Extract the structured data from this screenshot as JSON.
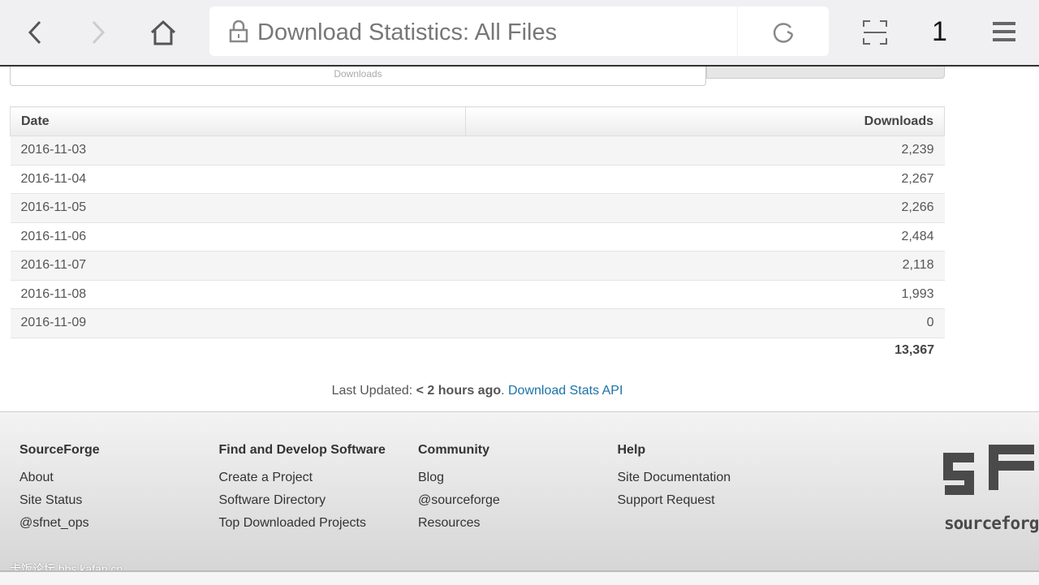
{
  "browser": {
    "page_title": "Download Statistics: All Files",
    "tab_count": "1"
  },
  "chart": {
    "x_label": "Downloads"
  },
  "table": {
    "headers": [
      "Date",
      "Downloads"
    ],
    "rows": [
      [
        "2016-11-03",
        "2,239"
      ],
      [
        "2016-11-04",
        "2,267"
      ],
      [
        "2016-11-05",
        "2,266"
      ],
      [
        "2016-11-06",
        "2,484"
      ],
      [
        "2016-11-07",
        "2,118"
      ],
      [
        "2016-11-08",
        "1,993"
      ],
      [
        "2016-11-09",
        "0"
      ]
    ],
    "total": "13,367"
  },
  "status": {
    "prefix": "Last Updated: ",
    "value": "< 2 hours ago",
    "dot": ". ",
    "api_link": "Download Stats API"
  },
  "footer": {
    "columns": [
      {
        "title": "SourceForge",
        "links": [
          "About",
          "Site Status",
          "@sfnet_ops"
        ]
      },
      {
        "title": "Find and Develop Software",
        "links": [
          "Create a Project",
          "Software Directory",
          "Top Downloaded Projects"
        ]
      },
      {
        "title": "Community",
        "links": [
          "Blog",
          "@sourceforge",
          "Resources"
        ]
      },
      {
        "title": "Help",
        "links": [
          "Site Documentation",
          "Support Request"
        ]
      }
    ],
    "logo_text": "sourceforge",
    "watermark": "卡饭论坛 bbs.kafan.cn"
  }
}
